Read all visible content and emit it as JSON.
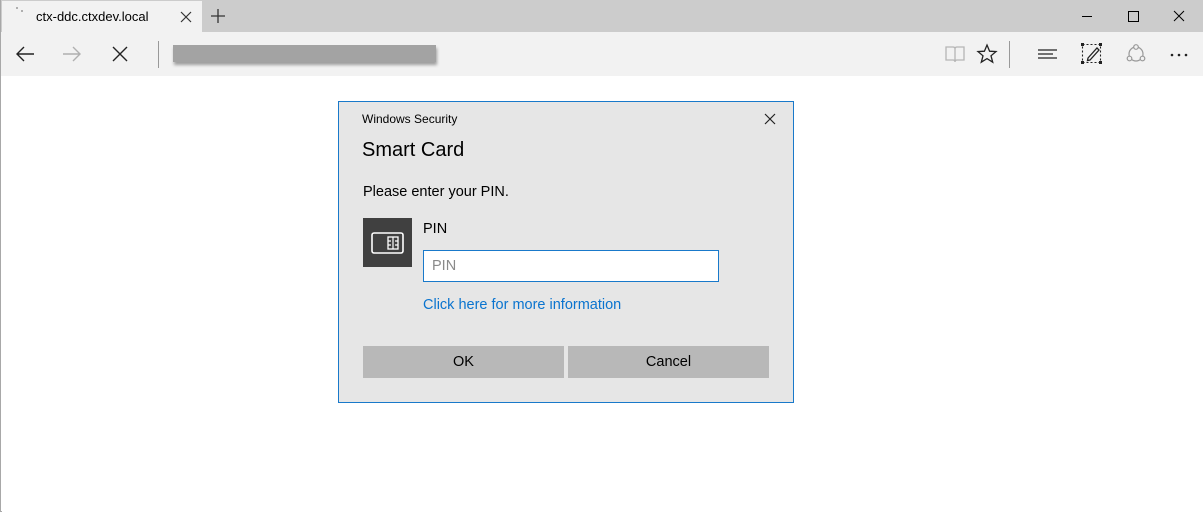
{
  "browser": {
    "tab": {
      "title": "ctx-ddc.ctxdev.local",
      "close_icon": "close-icon"
    },
    "new_tab_icon": "plus-icon",
    "window_controls": [
      "minimize-icon",
      "maximize-icon",
      "close-icon"
    ],
    "nav": {
      "back_icon": "arrow-left-icon",
      "forward_icon": "arrow-right-icon",
      "stop_icon": "close-icon",
      "address_value": "",
      "right_icons": [
        "reading-view-icon",
        "favorite-star-icon",
        "hub-icon",
        "web-note-icon",
        "share-icon",
        "more-icon"
      ]
    }
  },
  "dialog": {
    "caption": "Windows Security",
    "title": "Smart Card",
    "message": "Please enter your PIN.",
    "card_icon": "smart-card-icon",
    "pin_label": "PIN",
    "pin_value": "",
    "pin_placeholder": "PIN",
    "more_info_link": "Click here for more information",
    "ok_label": "OK",
    "cancel_label": "Cancel",
    "accent_color": "#1979ca",
    "link_color": "#0a74cf"
  }
}
